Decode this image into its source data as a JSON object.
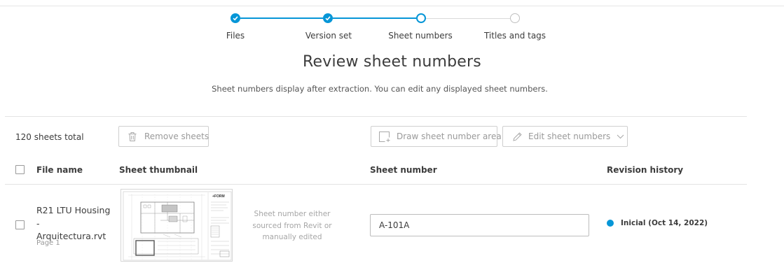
{
  "stepper": {
    "steps": [
      {
        "label": "Files",
        "state": "done"
      },
      {
        "label": "Version set",
        "state": "done"
      },
      {
        "label": "Sheet numbers",
        "state": "active"
      },
      {
        "label": "Titles and tags",
        "state": "todo"
      }
    ]
  },
  "header": {
    "title": "Review sheet numbers",
    "subtitle": "Sheet numbers display after extraction. You can edit any displayed sheet numbers."
  },
  "toolbar": {
    "count": "120 sheets total",
    "remove_label": "Remove sheets",
    "draw_label": "Draw sheet number area",
    "edit_label": "Edit sheet numbers"
  },
  "table": {
    "columns": {
      "file_name": "File name",
      "thumbnail": "Sheet thumbnail",
      "sheet_number": "Sheet number",
      "revision": "Revision history"
    },
    "rows": [
      {
        "file_line1": "R21 LTU Housing",
        "file_line2": "-",
        "file_line3": "Arquitectura.rvt",
        "page": "Page 1",
        "note": "Sheet number either sourced from Revit or manually edited",
        "sheet_number": "A-101A",
        "revision": "Inicial (Oct 14, 2022)"
      }
    ]
  },
  "colors": {
    "accent": "#0696d7",
    "border": "#cfcfcf",
    "muted_text": "#9a9a9a"
  }
}
